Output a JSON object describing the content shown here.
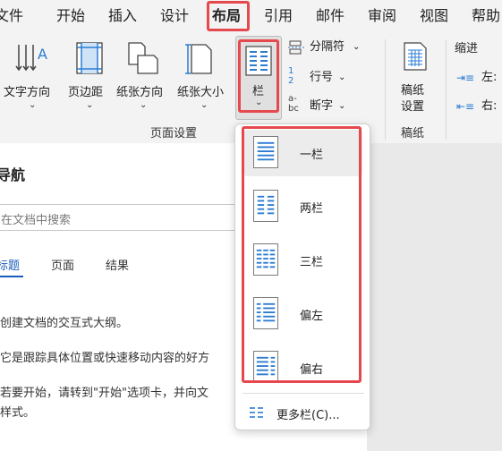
{
  "menubar": {
    "items": [
      "文件",
      "开始",
      "插入",
      "设计",
      "布局",
      "引用",
      "邮件",
      "审阅",
      "视图",
      "帮助"
    ]
  },
  "ribbon": {
    "text_direction": "文字方向",
    "margins": "页边距",
    "orientation": "纸张方向",
    "size": "纸张大小",
    "columns": "栏",
    "breaks": "分隔符",
    "line_numbers": "行号",
    "hyphenation": "断字",
    "page_setup_group": "页面设置",
    "draft_paper_label_1": "稿纸",
    "draft_paper_label_2": "设置",
    "draft_paper_group": "稿纸",
    "indent_title": "缩进",
    "indent_left": "左:",
    "indent_right": "右:"
  },
  "nav": {
    "title": "导航",
    "search_placeholder": "在文档中搜索",
    "tabs": [
      "标题",
      "页面",
      "结果"
    ],
    "messages": [
      "创建文档的交互式大纲。",
      "它是跟踪具体位置或快速移动内容的好方",
      "若要开始，请转到\"开始\"选项卡，并向文",
      "样式。"
    ]
  },
  "dropdown": {
    "items": [
      {
        "label": "一栏"
      },
      {
        "label": "两栏"
      },
      {
        "label": "三栏"
      },
      {
        "label": "偏左"
      },
      {
        "label": "偏右"
      }
    ],
    "more": "更多栏(C)..."
  },
  "colors": {
    "highlight": "#e5484d",
    "accent": "#185abd",
    "icon_blue": "#2b7cd3"
  }
}
